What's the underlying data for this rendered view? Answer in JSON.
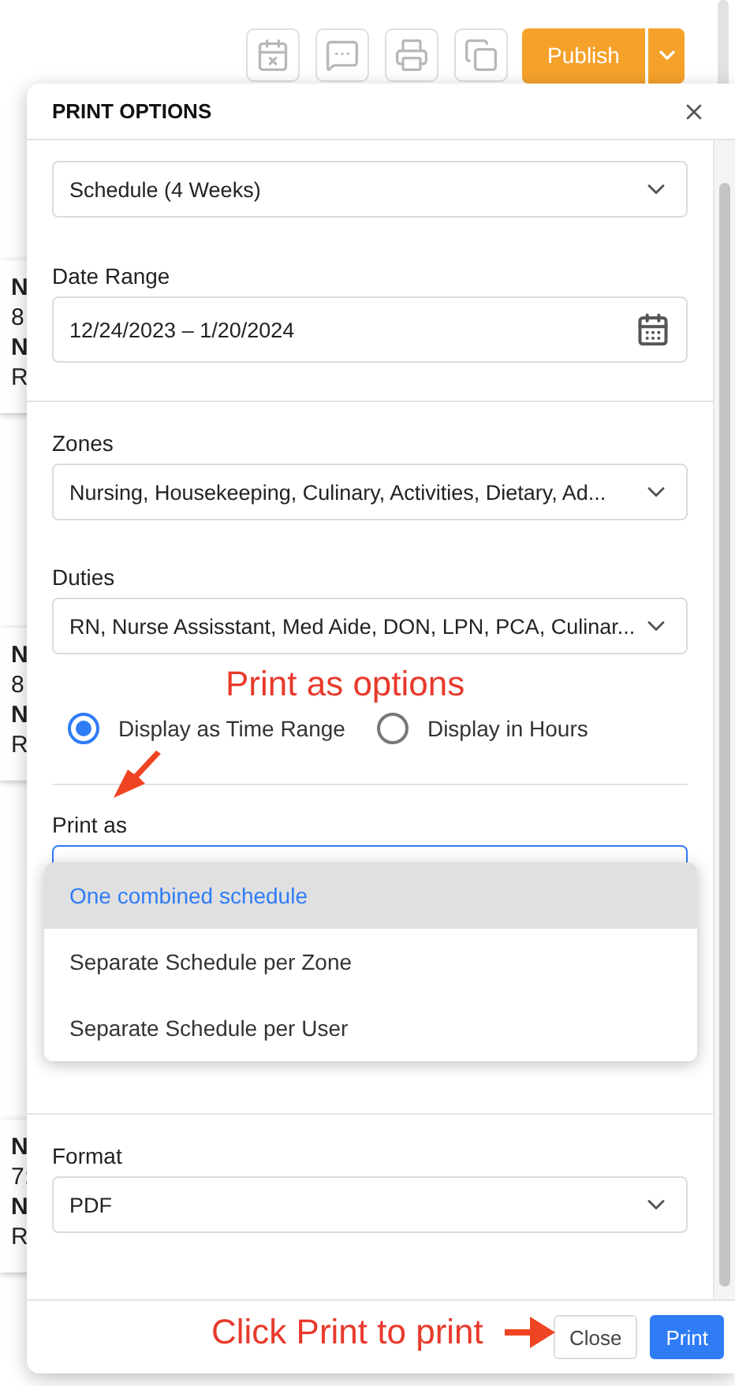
{
  "toolbar": {
    "publish": "Publish"
  },
  "background_cards": [
    {
      "lines": [
        "N",
        "8",
        "N",
        "R"
      ]
    },
    {
      "lines": [
        "N",
        "8",
        "N",
        "R"
      ]
    },
    {
      "lines": [
        "N",
        "7:",
        "N",
        "R"
      ]
    }
  ],
  "dialog": {
    "title": "PRINT OPTIONS",
    "sections": [
      {
        "fields": [
          {
            "kind": "select",
            "value": "Schedule (4 Weeks)"
          },
          {
            "kind": "date",
            "label": "Date Range",
            "value": "12/24/2023 – 1/20/2024"
          }
        ]
      },
      {
        "fields": [
          {
            "kind": "select",
            "label": "Zones",
            "value": "Nursing, Housekeeping, Culinary, Activities, Dietary, Ad..."
          },
          {
            "kind": "select",
            "label": "Duties",
            "value": "RN, Nurse Assisstant, Med Aide, DON, LPN, PCA, Culinar..."
          },
          {
            "kind": "radio",
            "options": [
              {
                "label": "Display as Time Range",
                "selected": true
              },
              {
                "label": "Display in Hours",
                "selected": false
              }
            ]
          },
          {
            "kind": "dropdown",
            "label": "Print as",
            "expanded": true,
            "options": [
              {
                "label": "One combined schedule",
                "selected": true
              },
              {
                "label": "Separate Schedule per Zone",
                "selected": false
              },
              {
                "label": "Separate Schedule per User",
                "selected": false
              }
            ]
          }
        ]
      },
      {
        "fields": [
          {
            "kind": "select",
            "label": "Format",
            "value": "PDF"
          }
        ]
      }
    ],
    "buttons": [
      {
        "label": "Close",
        "kind": "secondary"
      },
      {
        "label": "Print",
        "kind": "primary"
      }
    ]
  },
  "annotations": [
    {
      "text": "Print as options"
    },
    {
      "text": "Click Print to print"
    }
  ]
}
